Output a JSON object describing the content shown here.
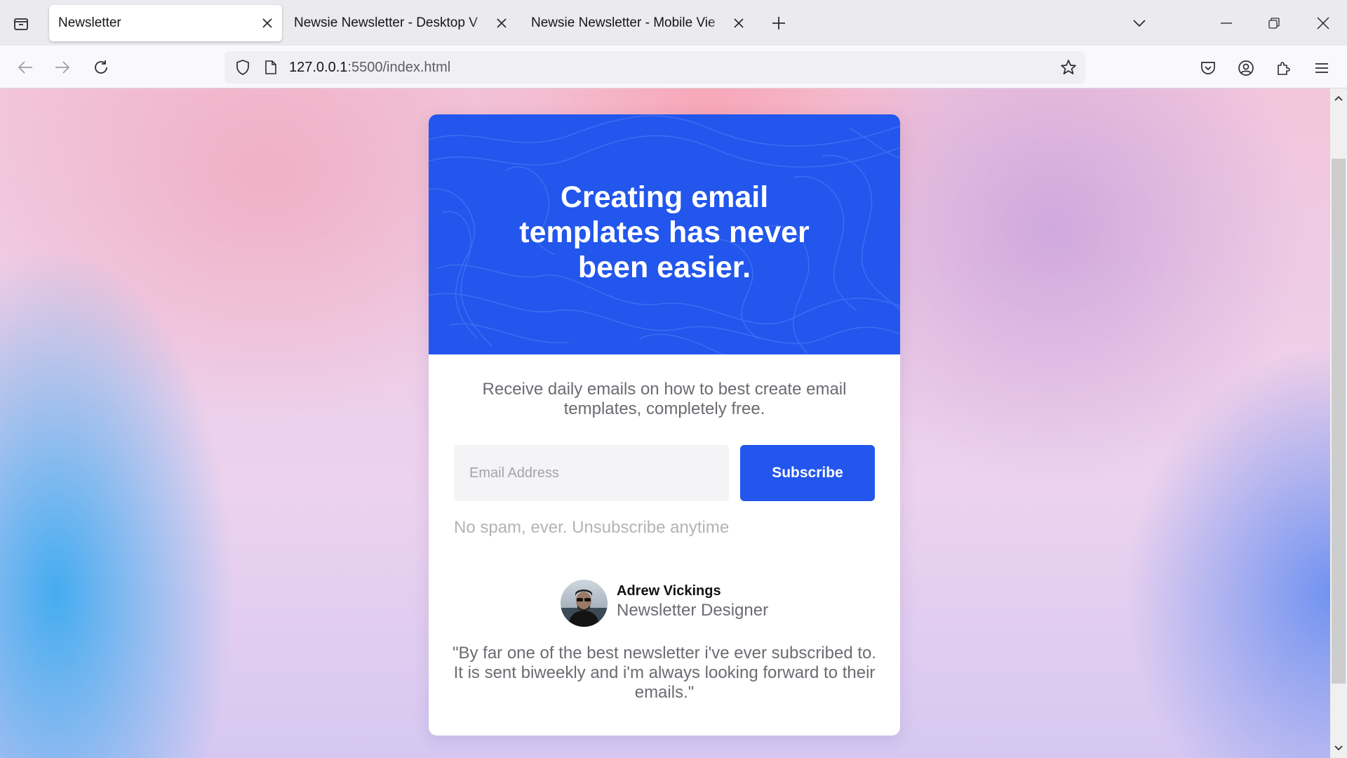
{
  "browser": {
    "tabs": [
      {
        "label": "Newsletter",
        "active": true
      },
      {
        "label": "Newsie Newsletter - Desktop View.p",
        "active": false
      },
      {
        "label": "Newsie Newsletter - Mobile View.pr",
        "active": false
      }
    ],
    "url": {
      "host": "127.0.0.1",
      "path": ":5500/index.html"
    },
    "icons": [
      "tab-overview-icon",
      "close-icon",
      "new-tab-icon",
      "tab-list-chevron-icon",
      "minimize-icon",
      "restore-icon",
      "window-close-icon",
      "back-icon",
      "forward-icon",
      "reload-icon",
      "shield-icon",
      "page-icon",
      "bookmark-star-icon",
      "pocket-icon",
      "account-icon",
      "extensions-icon",
      "menu-icon"
    ]
  },
  "newsletter": {
    "hero_title": "Creating email templates has never been easier.",
    "lead": "Receive daily emails on how to best create email templates, completely free.",
    "email_placeholder": "Email Address",
    "subscribe_label": "Subscribe",
    "disclaimer": "No spam, ever. Unsubscribe anytime",
    "author": {
      "name": "Adrew Vickings",
      "role": "Newsletter Designer"
    },
    "quote": "\"By far one of the best newsletter i've ever subscribed to. It is sent biweekly and i'm always looking forward to their emails.\""
  },
  "colors": {
    "accent": "#2256ec",
    "text_muted": "#6b6b72",
    "placeholder": "#a3a3aa"
  }
}
